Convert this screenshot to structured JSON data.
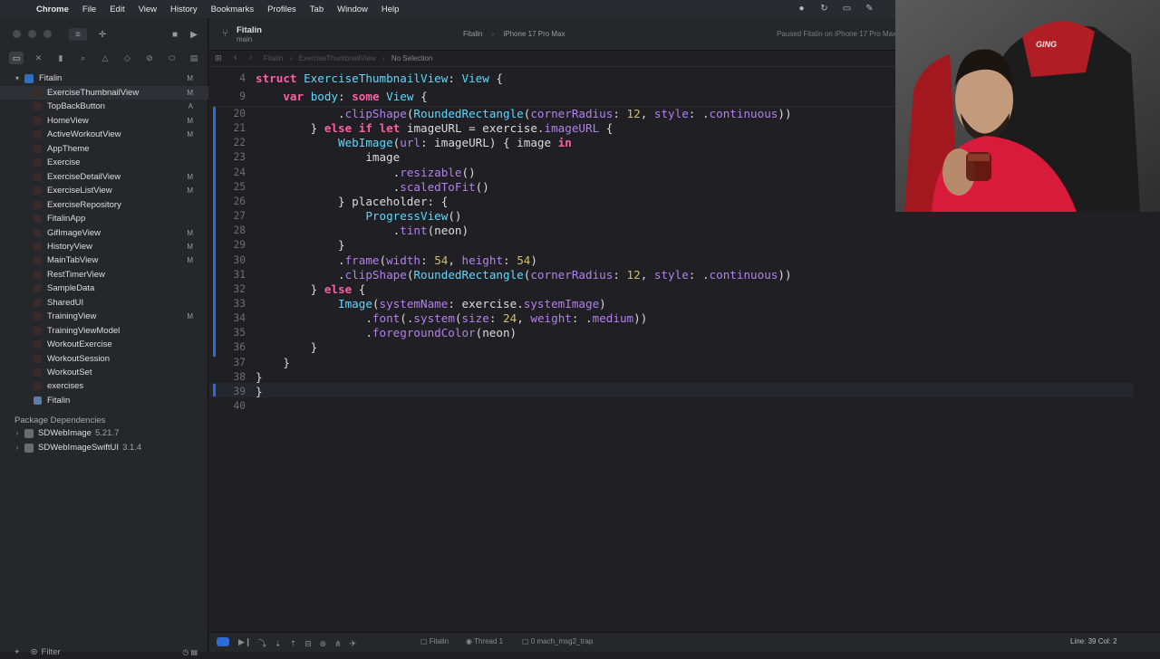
{
  "menubar": {
    "apple": "",
    "items": [
      "Chrome",
      "File",
      "Edit",
      "View",
      "History",
      "Bookmarks",
      "Profiles",
      "Tab",
      "Window",
      "Help"
    ]
  },
  "project": {
    "name": "Fitalin",
    "branch": "main",
    "scheme": "Fitalin",
    "device": "iPhone 17 Pro Max",
    "status": "Paused Fitalin on iPhone 17 Pro Max"
  },
  "jumpbar": {
    "crumb1": "Fitalin",
    "crumb2": "ExerciseThumbnailView",
    "crumb3": "No Selection"
  },
  "navigator": {
    "root": {
      "label": "Fitalin",
      "badge": "M"
    },
    "files": [
      {
        "label": "ExerciseThumbnailView",
        "badge": "M"
      },
      {
        "label": "TopBackButton",
        "badge": "A"
      },
      {
        "label": "HomeView",
        "badge": "M"
      },
      {
        "label": "ActiveWorkoutView",
        "badge": "M"
      },
      {
        "label": "AppTheme",
        "badge": ""
      },
      {
        "label": "Exercise",
        "badge": ""
      },
      {
        "label": "ExerciseDetailView",
        "badge": "M"
      },
      {
        "label": "ExerciseListView",
        "badge": "M"
      },
      {
        "label": "ExerciseRepository",
        "badge": ""
      },
      {
        "label": "FitalinApp",
        "badge": ""
      },
      {
        "label": "GifImageView",
        "badge": "M"
      },
      {
        "label": "HistoryView",
        "badge": "M"
      },
      {
        "label": "MainTabView",
        "badge": "M"
      },
      {
        "label": "RestTimerView",
        "badge": ""
      },
      {
        "label": "SampleData",
        "badge": ""
      },
      {
        "label": "SharedUI",
        "badge": ""
      },
      {
        "label": "TrainingView",
        "badge": "M"
      },
      {
        "label": "TrainingViewModel",
        "badge": ""
      },
      {
        "label": "WorkoutExercise",
        "badge": ""
      },
      {
        "label": "WorkoutSession",
        "badge": ""
      },
      {
        "label": "WorkoutSet",
        "badge": ""
      },
      {
        "label": "exercises",
        "badge": ""
      },
      {
        "label": "Fitalin",
        "badge": ""
      }
    ],
    "package_header": "Package Dependencies",
    "packages": [
      {
        "name": "SDWebImage",
        "version": "5.21.7"
      },
      {
        "name": "SDWebImageSwiftUI",
        "version": "3.1.4"
      }
    ],
    "filter_placeholder": "Filter"
  },
  "code": {
    "sticky": [
      {
        "n": "4",
        "text": "struct ExerciseThumbnailView: View {"
      },
      {
        "n": "9",
        "text": "    var body: some View {"
      }
    ],
    "lines": [
      {
        "n": "20",
        "text": "            .clipShape(RoundedRectangle(cornerRadius: 12, style: .continuous))"
      },
      {
        "n": "21",
        "text": "        } else if let imageURL = exercise.imageURL {"
      },
      {
        "n": "22",
        "text": "            WebImage(url: imageURL) { image in"
      },
      {
        "n": "23",
        "text": "                image"
      },
      {
        "n": "24",
        "text": "                    .resizable()"
      },
      {
        "n": "25",
        "text": "                    .scaledToFit()"
      },
      {
        "n": "26",
        "text": "            } placeholder: {"
      },
      {
        "n": "27",
        "text": "                ProgressView()"
      },
      {
        "n": "28",
        "text": "                    .tint(neon)"
      },
      {
        "n": "29",
        "text": "            }"
      },
      {
        "n": "30",
        "text": "            .frame(width: 54, height: 54)"
      },
      {
        "n": "31",
        "text": "            .clipShape(RoundedRectangle(cornerRadius: 12, style: .continuous))"
      },
      {
        "n": "32",
        "text": "        } else {"
      },
      {
        "n": "33",
        "text": "            Image(systemName: exercise.systemImage)"
      },
      {
        "n": "34",
        "text": "                .font(.system(size: 24, weight: .medium))"
      },
      {
        "n": "35",
        "text": "                .foregroundColor(neon)"
      },
      {
        "n": "36",
        "text": "        }"
      },
      {
        "n": "37",
        "text": "    }"
      },
      {
        "n": "38",
        "text": "}"
      },
      {
        "n": "39",
        "text": "}"
      },
      {
        "n": "40",
        "text": ""
      }
    ]
  },
  "debug": {
    "scheme": "Fitalin",
    "thread": "Thread 1",
    "frame": "0 mach_msg2_trap",
    "cursor": "Line: 39  Col: 2"
  },
  "colors": {
    "keyword": "#fc5fa3",
    "type": "#5dd8ff",
    "function": "#b281eb",
    "number": "#d0bf69",
    "accent": "#2d6bd6"
  },
  "webcam": {
    "chair_brand": "GING"
  }
}
